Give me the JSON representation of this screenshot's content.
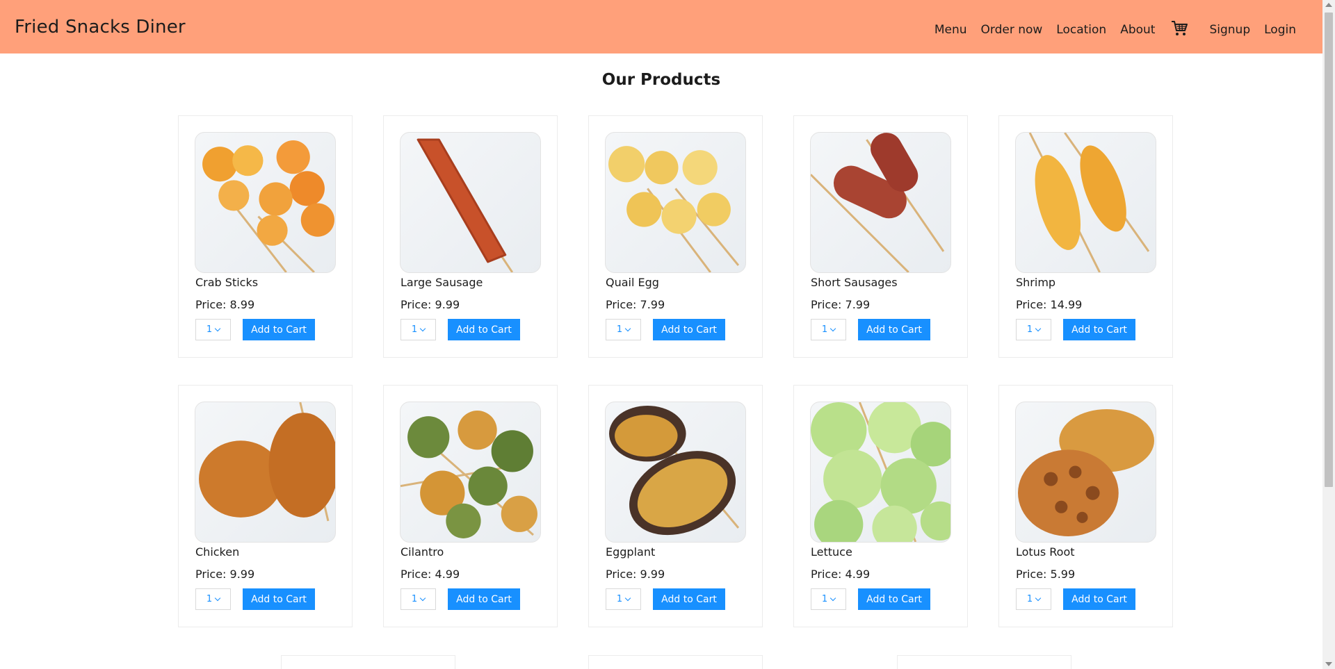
{
  "header": {
    "brand": "Fried Snacks Diner",
    "nav": [
      {
        "label": "Menu"
      },
      {
        "label": "Order now"
      },
      {
        "label": "Location"
      },
      {
        "label": "About"
      }
    ],
    "cart_icon": "shopping-cart-icon",
    "auth": [
      {
        "label": "Signup"
      },
      {
        "label": "Login"
      }
    ]
  },
  "main": {
    "title": "Our Products",
    "price_prefix": "Price: ",
    "add_to_cart_label": "Add to Cart",
    "products": [
      {
        "name": "Crab Sticks",
        "price": "8.99",
        "qty": "1"
      },
      {
        "name": "Large Sausage",
        "price": "9.99",
        "qty": "1"
      },
      {
        "name": "Quail Egg",
        "price": "7.99",
        "qty": "1"
      },
      {
        "name": "Short Sausages",
        "price": "7.99",
        "qty": "1"
      },
      {
        "name": "Shrimp",
        "price": "14.99",
        "qty": "1"
      },
      {
        "name": "Chicken",
        "price": "9.99",
        "qty": "1"
      },
      {
        "name": "Cilantro",
        "price": "4.99",
        "qty": "1"
      },
      {
        "name": "Eggplant",
        "price": "9.99",
        "qty": "1"
      },
      {
        "name": "Lettuce",
        "price": "4.99",
        "qty": "1"
      },
      {
        "name": "Lotus Root",
        "price": "5.99",
        "qty": "1"
      }
    ]
  },
  "colors": {
    "navbar": "#ffa07a",
    "primary_button": "#1890ff",
    "text": "#1c1c1c"
  }
}
